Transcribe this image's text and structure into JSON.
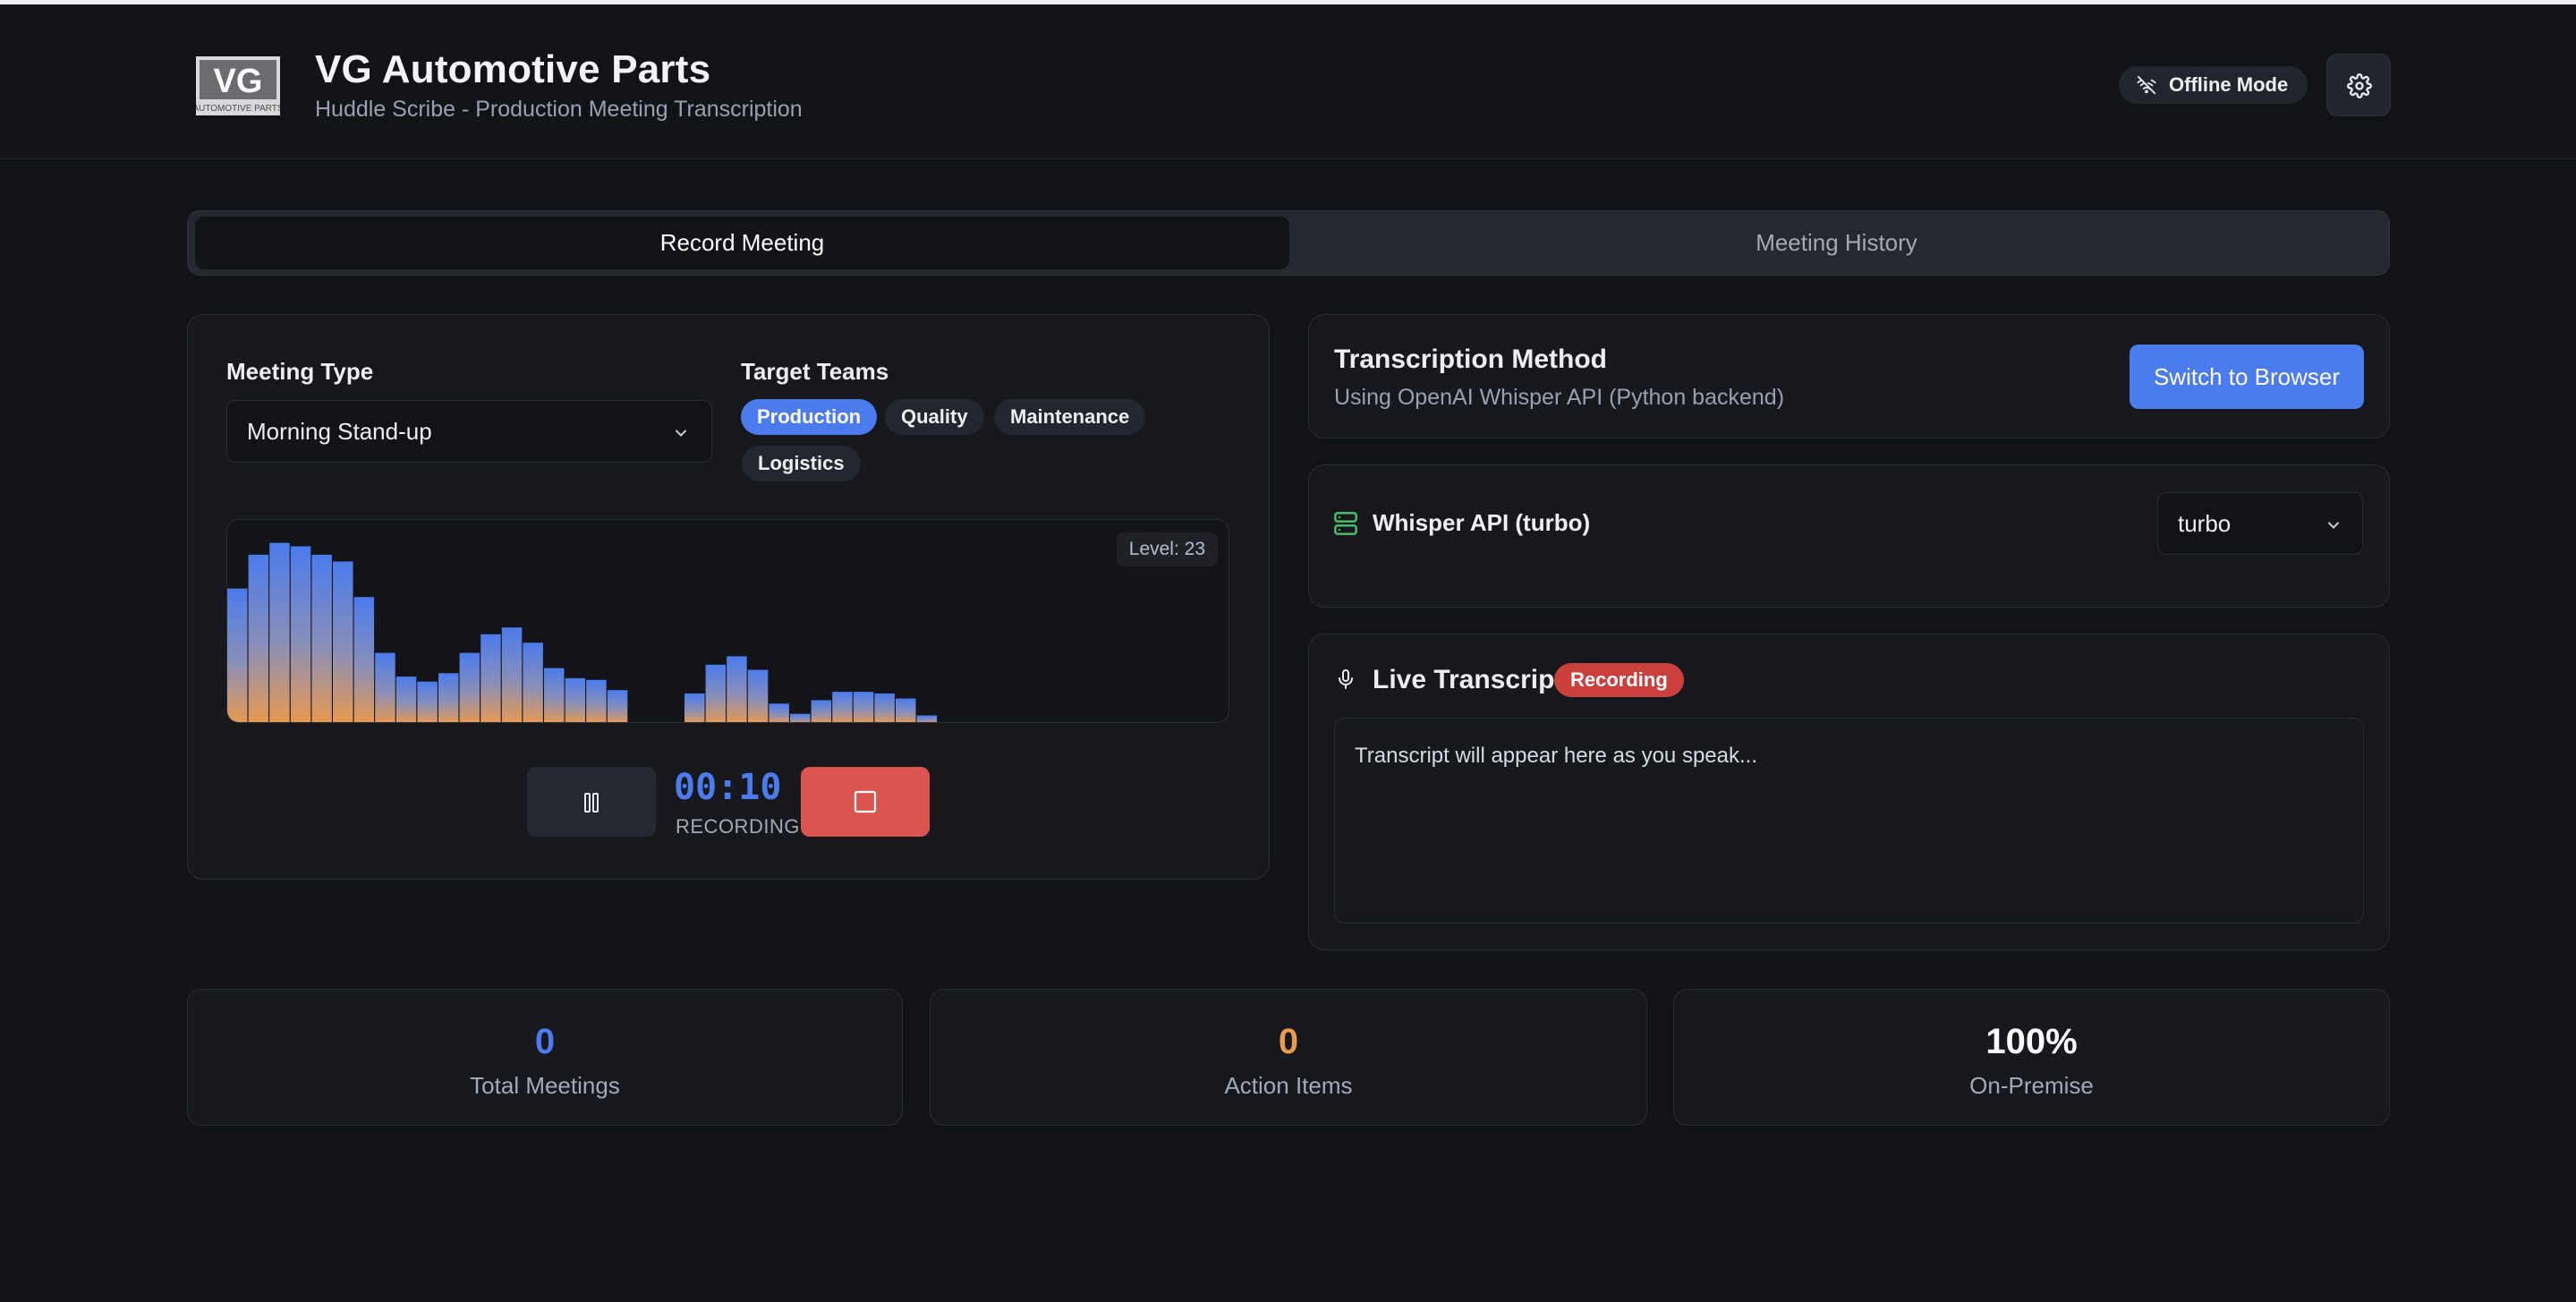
{
  "header": {
    "logo_letters": "VG",
    "logo_caption": "AUTOMOTIVE PARTS",
    "title": "VG Automotive Parts",
    "subtitle": "Huddle Scribe - Production Meeting Transcription",
    "offline_label": "Offline Mode",
    "offline_icon": "wifi-off-icon",
    "settings_icon": "gear-icon"
  },
  "tabs": [
    {
      "label": "Record Meeting",
      "active": true
    },
    {
      "label": "Meeting History",
      "active": false
    }
  ],
  "recorder": {
    "meeting_type_label": "Meeting Type",
    "meeting_type_value": "Morning Stand-up",
    "target_teams_label": "Target Teams",
    "teams": [
      {
        "label": "Production",
        "selected": true
      },
      {
        "label": "Quality",
        "selected": false
      },
      {
        "label": "Maintenance",
        "selected": false
      },
      {
        "label": "Logistics",
        "selected": false
      }
    ],
    "level_text": "Level: 23",
    "audio_levels": [
      80,
      100,
      107,
      105,
      100,
      96,
      75,
      42,
      28,
      25,
      30,
      42,
      53,
      57,
      48,
      33,
      27,
      26,
      20,
      0,
      0,
      0,
      0,
      0,
      0,
      0,
      0,
      0,
      0,
      0,
      0,
      0,
      0,
      0,
      0,
      0,
      0,
      0,
      0,
      0,
      0
    ],
    "audio_levels_second": [
      18,
      35,
      40,
      32,
      12,
      6,
      14,
      19,
      19,
      18,
      15,
      5
    ],
    "timer": "00:10",
    "status": "RECORDING",
    "colors": {
      "bar_top": "#4b7bec",
      "bar_bottom": "#e99a4f",
      "stop": "#db5450"
    }
  },
  "transcription": {
    "title": "Transcription Method",
    "subtitle": "Using OpenAI Whisper API (Python backend)",
    "switch_label": "Switch to Browser",
    "engine_label": "Whisper API (turbo)",
    "engine_icon": "server-icon",
    "model_value": "turbo"
  },
  "live": {
    "title": "Live Transcript",
    "mic_icon": "microphone-icon",
    "badge": "Recording",
    "placeholder": "Transcript will appear here as you speak..."
  },
  "stats": [
    {
      "value": "0",
      "label": "Total Meetings",
      "color": "#4b7bec"
    },
    {
      "value": "0",
      "label": "Action Items",
      "color": "#e99a4f"
    },
    {
      "value": "100%",
      "label": "On-Premise",
      "color": "#ffffff"
    }
  ]
}
